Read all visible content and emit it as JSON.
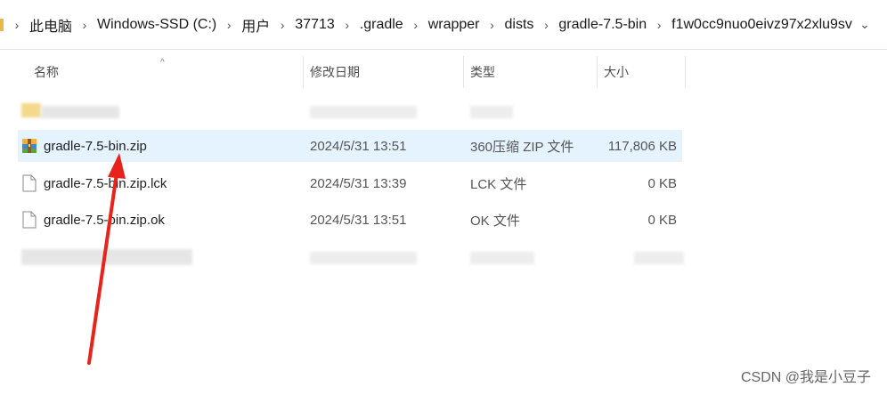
{
  "breadcrumb": {
    "items": [
      "此电脑",
      "Windows-SSD (C:)",
      "用户",
      "37713",
      ".gradle",
      "wrapper",
      "dists",
      "gradle-7.5-bin",
      "f1w0cc9nuo0eivz97x2xlu9sv"
    ]
  },
  "columns": {
    "name": "名称",
    "date": "修改日期",
    "type": "类型",
    "size": "大小"
  },
  "files": [
    {
      "name": "gradle-7.5-bin.zip",
      "date": "2024/5/31 13:51",
      "type": "360压缩 ZIP 文件",
      "size": "117,806 KB",
      "icon": "zip-archive-icon",
      "selected": true
    },
    {
      "name": "gradle-7.5-bin.zip.lck",
      "date": "2024/5/31 13:39",
      "type": "LCK 文件",
      "size": "0 KB",
      "icon": "blank-file-icon",
      "selected": false
    },
    {
      "name": "gradle-7.5-bin.zip.ok",
      "date": "2024/5/31 13:51",
      "type": "OK 文件",
      "size": "0 KB",
      "icon": "blank-file-icon",
      "selected": false
    }
  ],
  "watermark": "CSDN @我是小豆子",
  "colors": {
    "selection": "#e5f3ff",
    "annotation_arrow": "#e8231c",
    "folder": "#f3c64c"
  }
}
